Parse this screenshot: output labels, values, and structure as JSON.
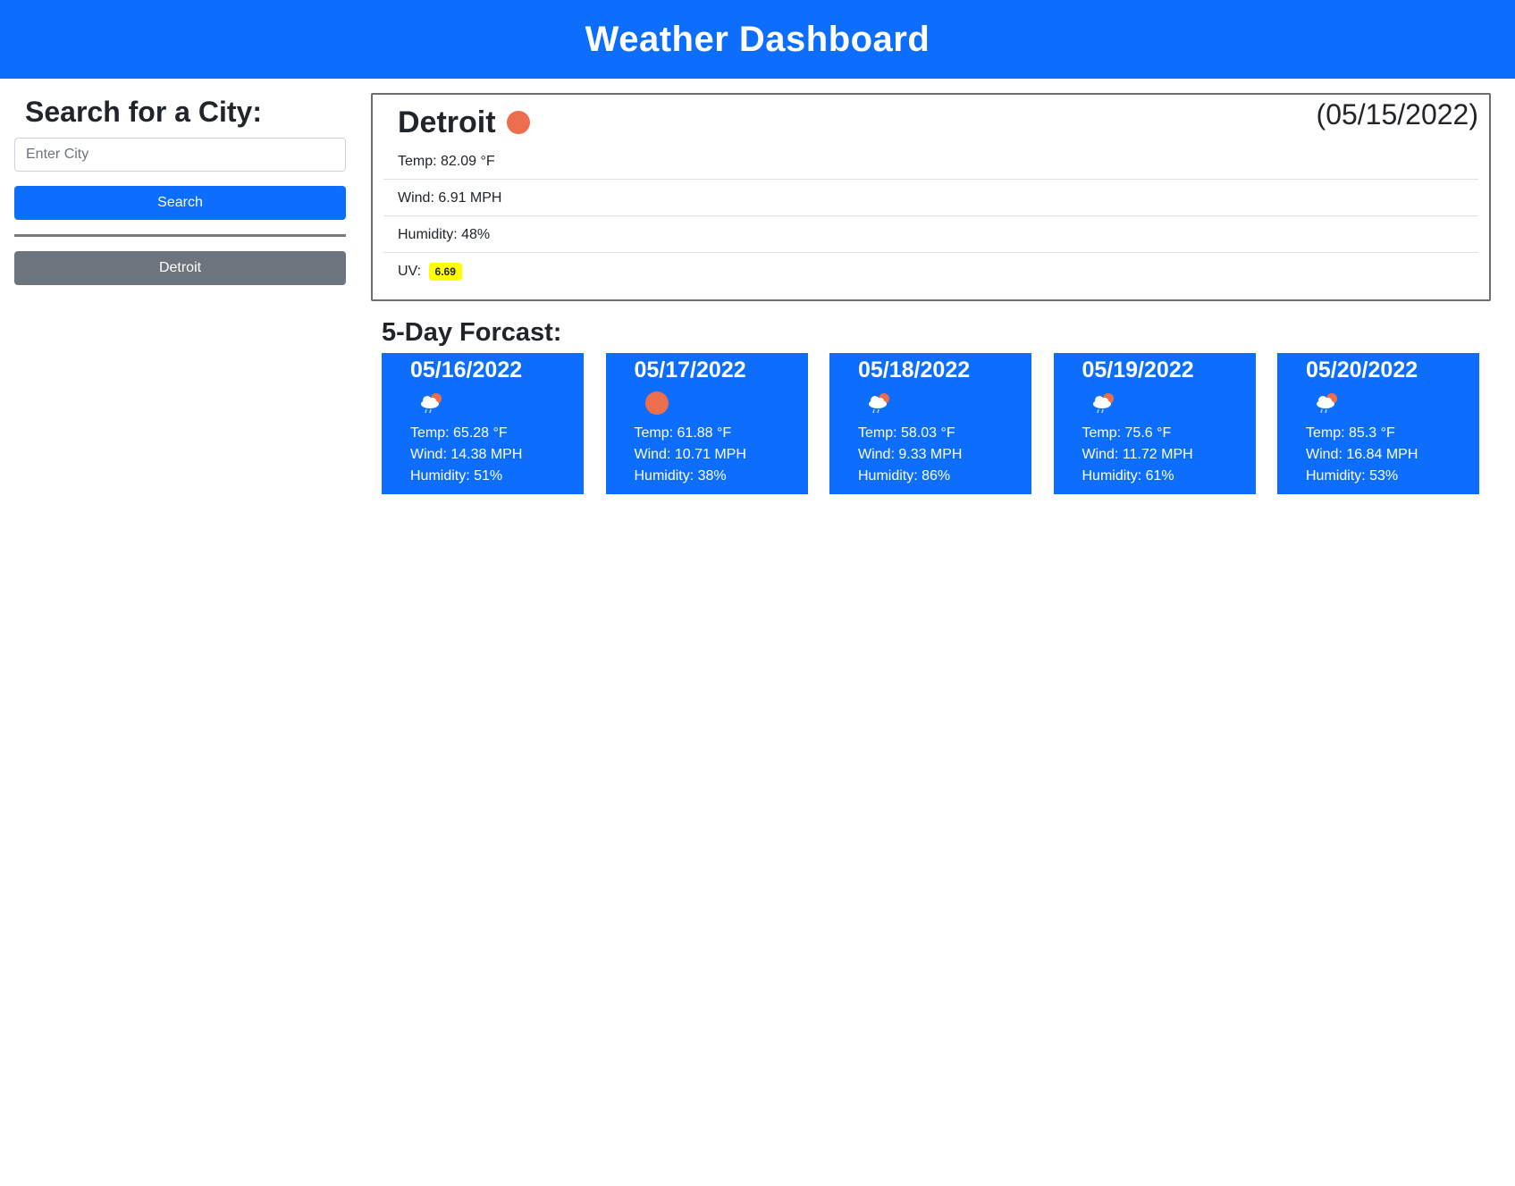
{
  "header": {
    "title": "Weather Dashboard"
  },
  "sidebar": {
    "heading": "Search for a City:",
    "search_placeholder": "Enter City",
    "search_value": "",
    "search_button": "Search",
    "history": [
      "Detroit"
    ]
  },
  "current": {
    "city": "Detroit",
    "icon": "sun-icon",
    "date": "(05/15/2022)",
    "temp": "Temp: 82.09 °F",
    "wind": "Wind: 6.91 MPH",
    "humidity": "Humidity: 48%",
    "uv_label": "UV:",
    "uv_value": "6.69",
    "uv_color": "#ffff00"
  },
  "forecast": {
    "heading": "5-Day Forcast:",
    "days": [
      {
        "date": "05/16/2022",
        "icon": "rain-cloud-icon",
        "temp": "Temp: 65.28 °F",
        "wind": "Wind: 14.38 MPH",
        "humidity": "Humidity: 51%"
      },
      {
        "date": "05/17/2022",
        "icon": "sun-icon",
        "temp": "Temp: 61.88 °F",
        "wind": "Wind: 10.71 MPH",
        "humidity": "Humidity: 38%"
      },
      {
        "date": "05/18/2022",
        "icon": "rain-cloud-icon",
        "temp": "Temp: 58.03 °F",
        "wind": "Wind: 9.33 MPH",
        "humidity": "Humidity: 86%"
      },
      {
        "date": "05/19/2022",
        "icon": "rain-cloud-icon",
        "temp": "Temp: 75.6 °F",
        "wind": "Wind: 11.72 MPH",
        "humidity": "Humidity: 61%"
      },
      {
        "date": "05/20/2022",
        "icon": "rain-cloud-icon",
        "temp": "Temp: 85.3 °F",
        "wind": "Wind: 16.84 MPH",
        "humidity": "Humidity: 53%"
      }
    ]
  },
  "colors": {
    "primary": "#0d6efd",
    "secondary": "#6c757d",
    "sun": "#ec6e4c",
    "uv": "#ffff00"
  }
}
